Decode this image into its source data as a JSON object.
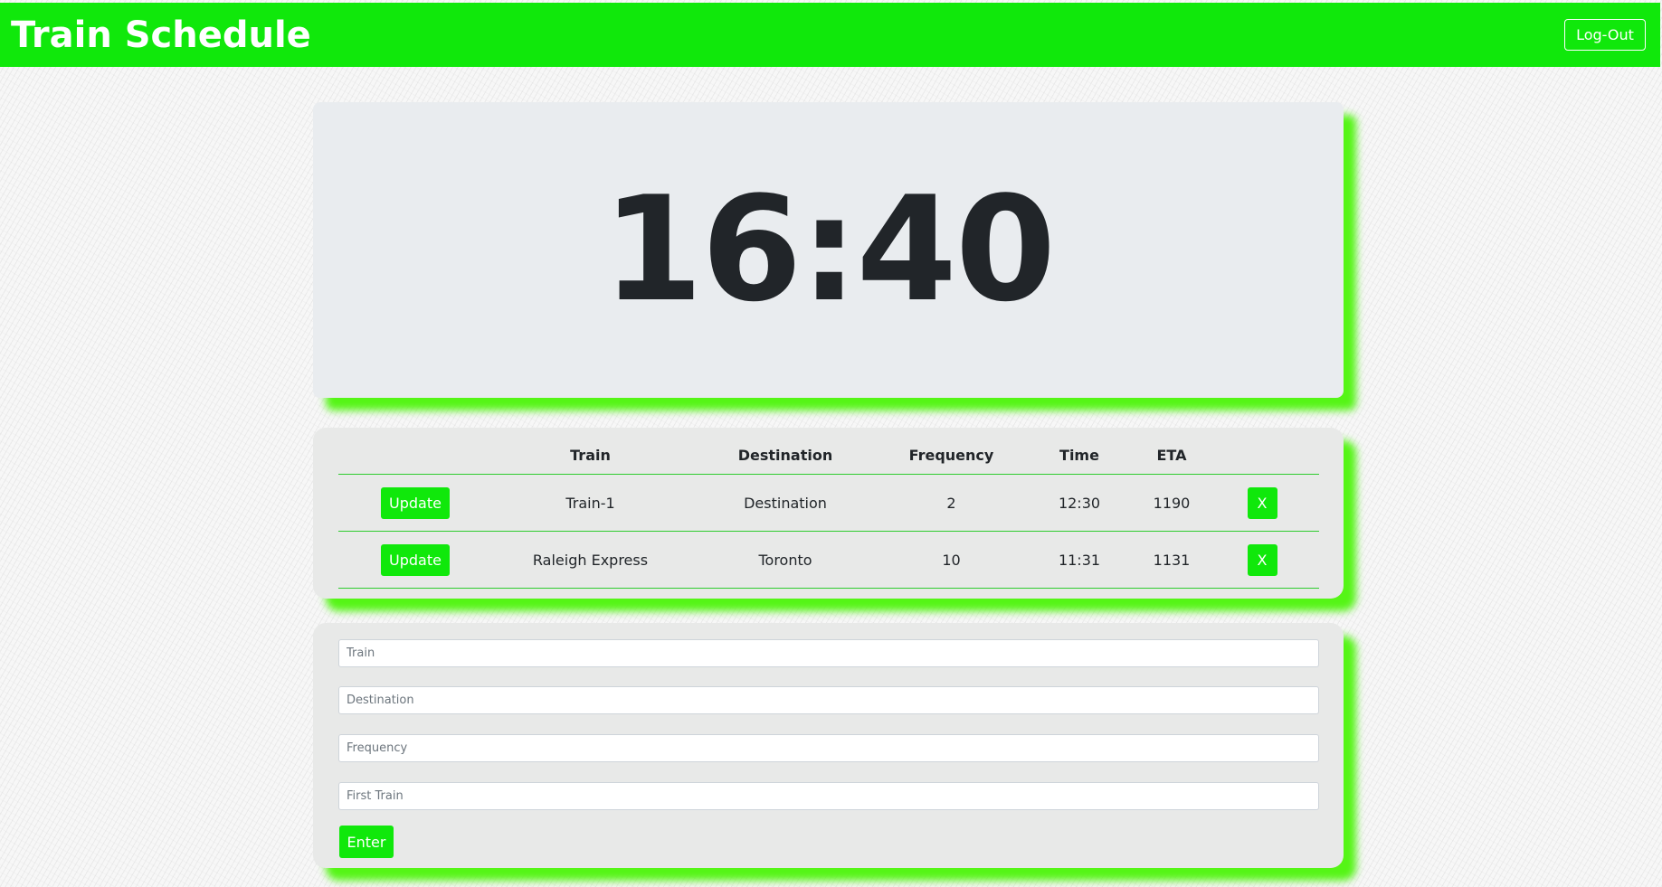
{
  "navbar": {
    "title": "Train Schedule",
    "logout_label": "Log-Out",
    "accent_color": "#10e80b"
  },
  "clock": {
    "time": "16:40"
  },
  "schedule": {
    "headers": [
      "",
      "Train",
      "Destination",
      "Frequency",
      "Time",
      "ETA",
      ""
    ],
    "update_label": "Update",
    "remove_label": "X",
    "rows": [
      {
        "train": "Train-1",
        "destination": "Destination",
        "frequency": "2",
        "time": "12:30",
        "eta": "1190"
      },
      {
        "train": "Raleigh Express",
        "destination": "Toronto",
        "frequency": "10",
        "time": "11:31",
        "eta": "1131"
      }
    ]
  },
  "form": {
    "train_placeholder": "Train",
    "destination_placeholder": "Destination",
    "frequency_placeholder": "Frequency",
    "first_train_placeholder": "First Train",
    "train_value": "",
    "destination_value": "",
    "frequency_value": "",
    "first_train_value": "",
    "submit_label": "Enter"
  }
}
